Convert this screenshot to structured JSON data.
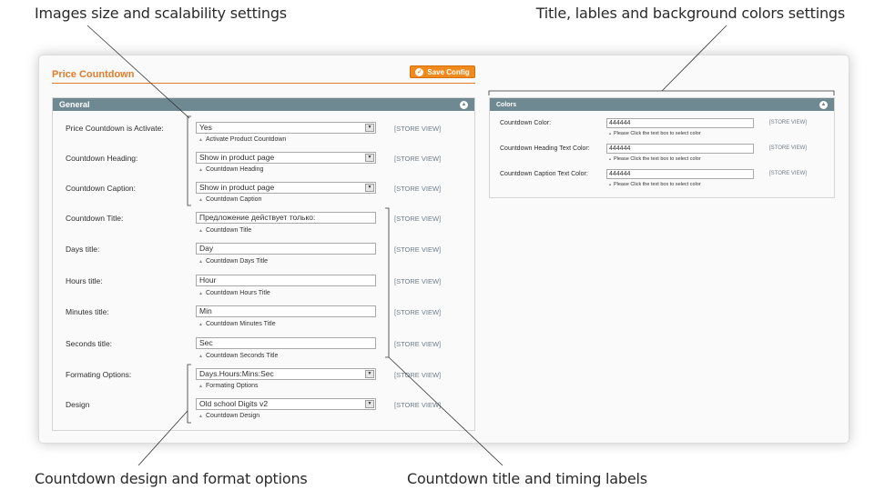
{
  "callouts": {
    "top_left": "Images size and scalability settings",
    "top_right": "Title, lables and background colors settings",
    "bottom_left": "Countdown design and format options",
    "bottom_right": "Countdown title and timing labels"
  },
  "page": {
    "title": "Price Countdown",
    "save_button": "Save Config",
    "accent_color": "#e07b2c",
    "button_color": "#f08a1d",
    "section_header_color": "#6f8992"
  },
  "general": {
    "header": "General",
    "scope_label": "[STORE VIEW]",
    "fields": [
      {
        "label": "Price Countdown is Activate:",
        "value": "Yes",
        "hint": "Activate Product Countdown",
        "type": "select"
      },
      {
        "label": "Countdown Heading:",
        "value": "Show in product page",
        "hint": "Countdown Heading",
        "type": "select"
      },
      {
        "label": "Countdown Caption:",
        "value": "Show in product page",
        "hint": "Countdown Caption",
        "type": "select"
      },
      {
        "label": "Countdown Title:",
        "value": "Предложение действует только:",
        "hint": "Countdown Title",
        "type": "text"
      },
      {
        "label": "Days title:",
        "value": "Day",
        "hint": "Countdown Days Title",
        "type": "text"
      },
      {
        "label": "Hours title:",
        "value": "Hour",
        "hint": "Countdown Hours Title",
        "type": "text"
      },
      {
        "label": "Minutes title:",
        "value": "Min",
        "hint": "Countdown Minutes Title",
        "type": "text"
      },
      {
        "label": "Seconds title:",
        "value": "Sec",
        "hint": "Countdown Seconds Title",
        "type": "text"
      },
      {
        "label": "Formating Options:",
        "value": "Days.Hours:Mins:Sec",
        "hint": "Formating Options",
        "type": "select"
      },
      {
        "label": "Design",
        "value": "Old school Digits v2",
        "hint": "Countdown Design",
        "type": "select"
      }
    ]
  },
  "colors": {
    "header": "Colors",
    "scope_label": "[STORE VIEW]",
    "fields": [
      {
        "label": "Countdown Color:",
        "value": "444444",
        "hint": "Please Click the text box to select color"
      },
      {
        "label": "Countdown Heading Text Color:",
        "value": "444444",
        "hint": "Please Click the text box to select color"
      },
      {
        "label": "Countdown Caption Text Color:",
        "value": "444444",
        "hint": "Please Click the text box to select color"
      }
    ]
  }
}
